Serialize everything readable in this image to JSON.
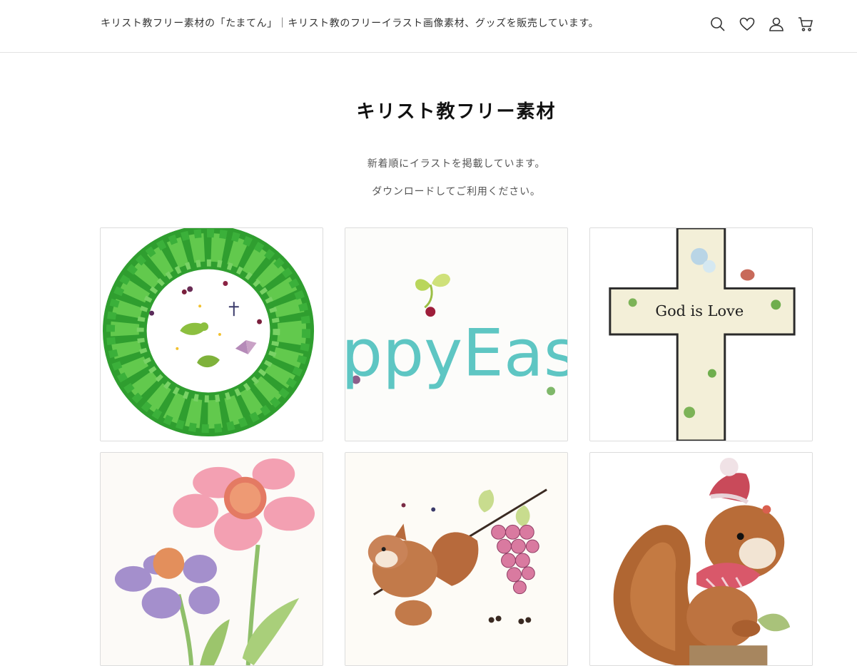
{
  "header": {
    "site_title": "キリスト教フリー素材の「たまてん」｜キリスト教のフリーイラスト画像素材、グッズを販売しています。",
    "icons": [
      "search-icon",
      "heart-icon",
      "account-icon",
      "cart-icon"
    ]
  },
  "main": {
    "title": "キリスト教フリー素材",
    "intro_line_1": "新着順にイラストを掲載しています。",
    "intro_line_2": "ダウンロードしてご利用ください。"
  },
  "gallery": {
    "items": [
      {
        "name": "wreath-with-birds-illustration",
        "card_text": ""
      },
      {
        "name": "happy-easter-lettering-illustration",
        "card_text": "ppyEas"
      },
      {
        "name": "god-is-love-cross-illustration",
        "card_text": "God is Love"
      },
      {
        "name": "pink-purple-flowers-illustration",
        "card_text": ""
      },
      {
        "name": "squirrel-with-grapes-illustration",
        "card_text": ""
      },
      {
        "name": "squirrel-with-hat-illustration",
        "card_text": ""
      }
    ]
  },
  "colors": {
    "text": "#333333",
    "border": "#dcdcdc",
    "wreath_green": "#3fb33a"
  }
}
